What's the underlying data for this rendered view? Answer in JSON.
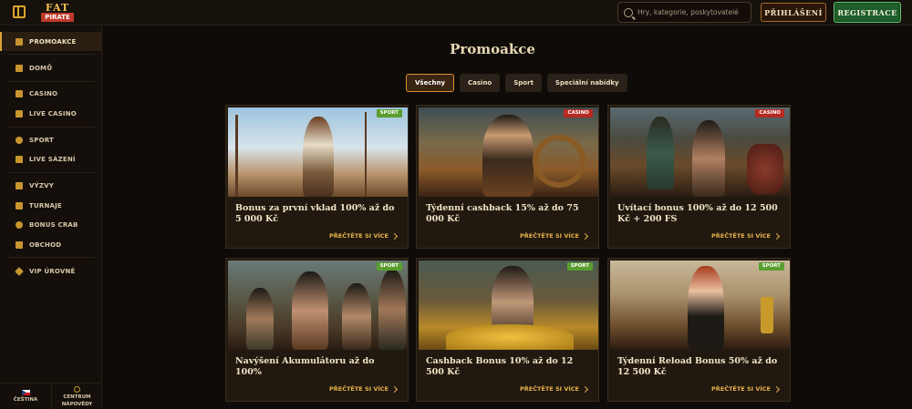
{
  "header": {
    "logo_text_top": "FAT",
    "logo_text_bottom": "PIRATE",
    "search_placeholder": "Hry, kategorie, poskytovatelé",
    "login_label": "PŘIHLÁŠENÍ",
    "register_label": "REGISTRACE"
  },
  "sidebar": {
    "items": [
      {
        "label": "PROMOAKCE",
        "icon": "promo-icon",
        "active": true
      },
      {
        "label": "DOMŮ",
        "icon": "home-icon"
      },
      {
        "label": "CASINO",
        "icon": "casino-icon"
      },
      {
        "label": "LIVE CASINO",
        "icon": "live-casino-icon"
      },
      {
        "label": "SPORT",
        "icon": "sport-icon"
      },
      {
        "label": "LIVE SÁZENÍ",
        "icon": "live-betting-icon"
      },
      {
        "label": "VÝZVY",
        "icon": "trophy-icon"
      },
      {
        "label": "TURNAJE",
        "icon": "tournament-icon"
      },
      {
        "label": "BONUS CRAB",
        "icon": "crab-icon"
      },
      {
        "label": "OBCHOD",
        "icon": "shop-icon"
      },
      {
        "label": "VIP ÚROVNĚ",
        "icon": "diamond-icon"
      }
    ],
    "language_label": "ČEŠTINA",
    "help_label_1": "CENTRUM",
    "help_label_2": "NÁPOVĚDY"
  },
  "main": {
    "title": "Promoakce",
    "tabs": [
      {
        "label": "Všechny",
        "active": true
      },
      {
        "label": "Casino"
      },
      {
        "label": "Sport"
      },
      {
        "label": "Speciální nabídky"
      }
    ],
    "cards": [
      {
        "title": "Bonus za první vklad 100% až do 5 000 Kč",
        "badge": "SPORT",
        "link": "PŘEČTĚTE SI VÍCE"
      },
      {
        "title": "Týdenní cashback 15% až do 75 000 Kč",
        "badge": "CASINO",
        "link": "PŘEČTĚTE SI VÍCE"
      },
      {
        "title": "Uvítací bonus 100% až do 12 500 Kč + 200 FS",
        "badge": "CASINO",
        "link": "PŘEČTĚTE SI VÍCE"
      },
      {
        "title": "Navýšení Akumulátoru až do 100%",
        "badge": "SPORT",
        "link": "PŘEČTĚTE SI VÍCE"
      },
      {
        "title": "Cashback Bonus 10% až do 12 500 Kč",
        "badge": "SPORT",
        "link": "PŘEČTĚTE SI VÍCE"
      },
      {
        "title": "Týdenní Reload Bonus 50% až do 12 500 Kč",
        "badge": "SPORT",
        "link": "PŘEČTĚTE SI VÍCE"
      }
    ]
  },
  "colors": {
    "accent_gold": "#d9a531",
    "sport_badge": "#5a9e2f",
    "casino_badge": "#b52a22",
    "register_green": "#1f5e2a"
  }
}
